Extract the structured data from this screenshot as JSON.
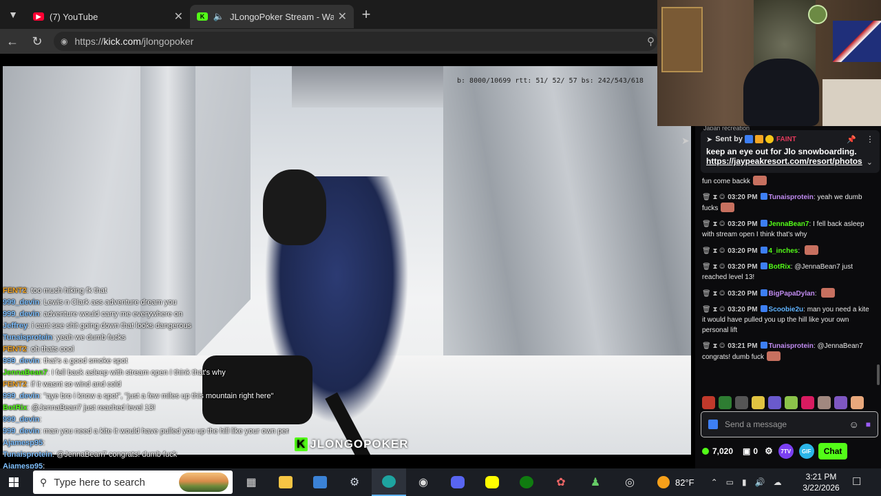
{
  "browser": {
    "tabs": [
      {
        "title": "(7) YouTube",
        "favicon": "youtube-icon",
        "color": "#ff0033"
      },
      {
        "title": "JLongoPoker Stream - Watch Live on Kick",
        "favicon": "kick-icon",
        "color": "#53fc18"
      }
    ],
    "url_prefix": "https://",
    "url_domain": "kick.com",
    "url_path": "/jlongopoker"
  },
  "video": {
    "stats": "b:  8000/10699  rtt:  51/ 52/ 57  bs:  242/543/618",
    "watermark": "JLONGOPOKER",
    "watermark_k": "K"
  },
  "overlay_chat": [
    {
      "user": "FENT2",
      "text": "too much hiking fk that",
      "cls": "o"
    },
    {
      "user": "999_devin",
      "text": "Lewis n Clark ass adventure dream you",
      "cls": ""
    },
    {
      "user": "999_devin",
      "text": "adventure would carry me everywhere on",
      "cls": ""
    },
    {
      "user": "Jeffrey",
      "text": "i cant see shit going down that looks dangerous",
      "cls": ""
    },
    {
      "user": "Tunaisprotein",
      "text": "yeah we dumb fucks",
      "cls": ""
    },
    {
      "user": "FENT2",
      "text": "oh thats cool",
      "cls": "o"
    },
    {
      "user": "999_devin",
      "text": "that's a good smoke spot",
      "cls": ""
    },
    {
      "user": "JennaBean7",
      "text": "I fell back asleep with stream open I think that's why",
      "cls": "g"
    },
    {
      "user": "FENT2",
      "text": "if it wasnt so wind and cold",
      "cls": "o"
    },
    {
      "user": "999_devin",
      "text": "\"aye bro i know a spot\", \"just a few miles up this mountain right here\"",
      "cls": ""
    },
    {
      "user": "BotRix",
      "text": "@JennaBean7 just reached level 13!",
      "cls": "g"
    },
    {
      "user": "999_devin",
      "text": "",
      "cls": ""
    },
    {
      "user": "999_devin",
      "text": "man you need a kite it would have pulled you up the hill like your own personal lift",
      "cls": ""
    },
    {
      "user": "Ajamesp95",
      "text": "",
      "cls": ""
    },
    {
      "user": "Tunaisprotein",
      "text": "@JennaBean7 congrats! dumb fuck",
      "cls": ""
    },
    {
      "user": "Ajamesp95",
      "text": "",
      "cls": ""
    },
    {
      "user": "Ajamesp95",
      "text": "",
      "cls": ""
    },
    {
      "user": "Ajamesp95",
      "text": "",
      "cls": ""
    }
  ],
  "chat": {
    "top_snippet": "Japan recreation",
    "pinned": {
      "sent_by": "Sent by",
      "sender": "FAINT",
      "message": "keep an eye out for Jlo snowboarding.",
      "link": "https://jaypeakresort.com/resort/photos"
    },
    "messages": [
      {
        "time": "",
        "user": "",
        "text": "fun come backk",
        "user_color": "#ffffff",
        "emote": true
      },
      {
        "time": "03:20 PM",
        "user": "Tunaisprotein",
        "text": "yeah we dumb fucks",
        "user_color": "#c08bf0",
        "emote": true
      },
      {
        "time": "03:20 PM",
        "user": "JennaBean7",
        "text": "I fell back asleep with stream open I think that's why",
        "user_color": "#53fc18",
        "emote": false
      },
      {
        "time": "03:20 PM",
        "user": "4_inches",
        "text": "",
        "user_color": "#53fc18",
        "emote": true
      },
      {
        "time": "03:20 PM",
        "user": "BotRix",
        "text": "@JennaBean7 just reached level 13!",
        "user_color": "#53fc18",
        "emote": false
      },
      {
        "time": "03:20 PM",
        "user": "BigPapaDylan",
        "text": "",
        "user_color": "#c08bf0",
        "emote": true
      },
      {
        "time": "03:20 PM",
        "user": "Scoobie2u",
        "text": "man you need a kite it would have pulled you up the hill like your own personal lift",
        "user_color": "#5fb3ff",
        "emote": false
      },
      {
        "time": "03:21 PM",
        "user": "Tunaisprotein",
        "text": "@JennaBean7 congrats! dumb fuck",
        "user_color": "#c08bf0",
        "emote": true
      }
    ],
    "input_placeholder": "Send a message",
    "points": "7,020",
    "zero": "0",
    "btn_7tv": "7TV",
    "btn_gif": "GIF",
    "chat_button": "Chat"
  },
  "taskbar": {
    "search_placeholder": "Type here to search",
    "temperature": "82°F",
    "time": "3:21 PM",
    "date": "3/22/2026"
  }
}
